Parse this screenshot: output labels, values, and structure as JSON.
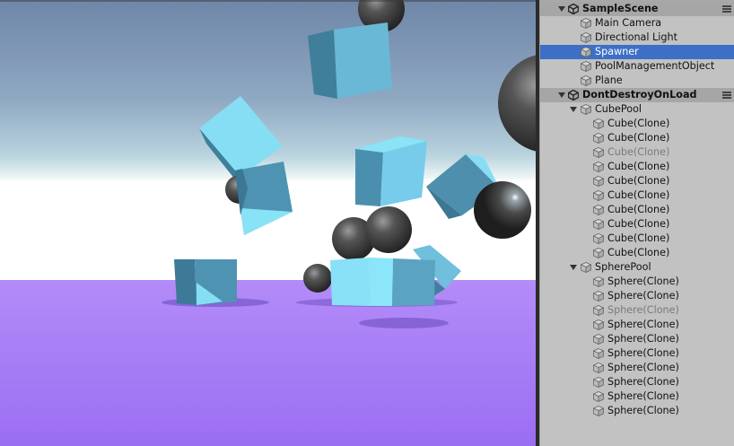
{
  "hierarchy": {
    "scenes": [
      {
        "name": "SampleScene",
        "items": [
          {
            "label": "Main Camera",
            "selected": false,
            "dim": false
          },
          {
            "label": "Directional Light",
            "selected": false,
            "dim": false
          },
          {
            "label": "Spawner",
            "selected": true,
            "dim": false
          },
          {
            "label": "PoolManagementObject",
            "selected": false,
            "dim": false
          },
          {
            "label": "Plane",
            "selected": false,
            "dim": false
          }
        ]
      },
      {
        "name": "DontDestroyOnLoad",
        "groups": [
          {
            "label": "CubePool",
            "children": [
              {
                "label": "Cube(Clone)",
                "dim": false
              },
              {
                "label": "Cube(Clone)",
                "dim": false
              },
              {
                "label": "Cube(Clone)",
                "dim": true
              },
              {
                "label": "Cube(Clone)",
                "dim": false
              },
              {
                "label": "Cube(Clone)",
                "dim": false
              },
              {
                "label": "Cube(Clone)",
                "dim": false
              },
              {
                "label": "Cube(Clone)",
                "dim": false
              },
              {
                "label": "Cube(Clone)",
                "dim": false
              },
              {
                "label": "Cube(Clone)",
                "dim": false
              },
              {
                "label": "Cube(Clone)",
                "dim": false
              }
            ]
          },
          {
            "label": "SpherePool",
            "children": [
              {
                "label": "Sphere(Clone)",
                "dim": false
              },
              {
                "label": "Sphere(Clone)",
                "dim": false
              },
              {
                "label": "Sphere(Clone)",
                "dim": true
              },
              {
                "label": "Sphere(Clone)",
                "dim": false
              },
              {
                "label": "Sphere(Clone)",
                "dim": false
              },
              {
                "label": "Sphere(Clone)",
                "dim": false
              },
              {
                "label": "Sphere(Clone)",
                "dim": false
              },
              {
                "label": "Sphere(Clone)",
                "dim": false
              },
              {
                "label": "Sphere(Clone)",
                "dim": false
              },
              {
                "label": "Sphere(Clone)",
                "dim": false
              }
            ]
          }
        ]
      }
    ]
  },
  "colors": {
    "selection": "#3d6fc6",
    "floor": "#a87cf5",
    "cube_light": "#7fdcf2",
    "cube_dark": "#3f7f9c",
    "sphere": "#3a3a3a"
  }
}
